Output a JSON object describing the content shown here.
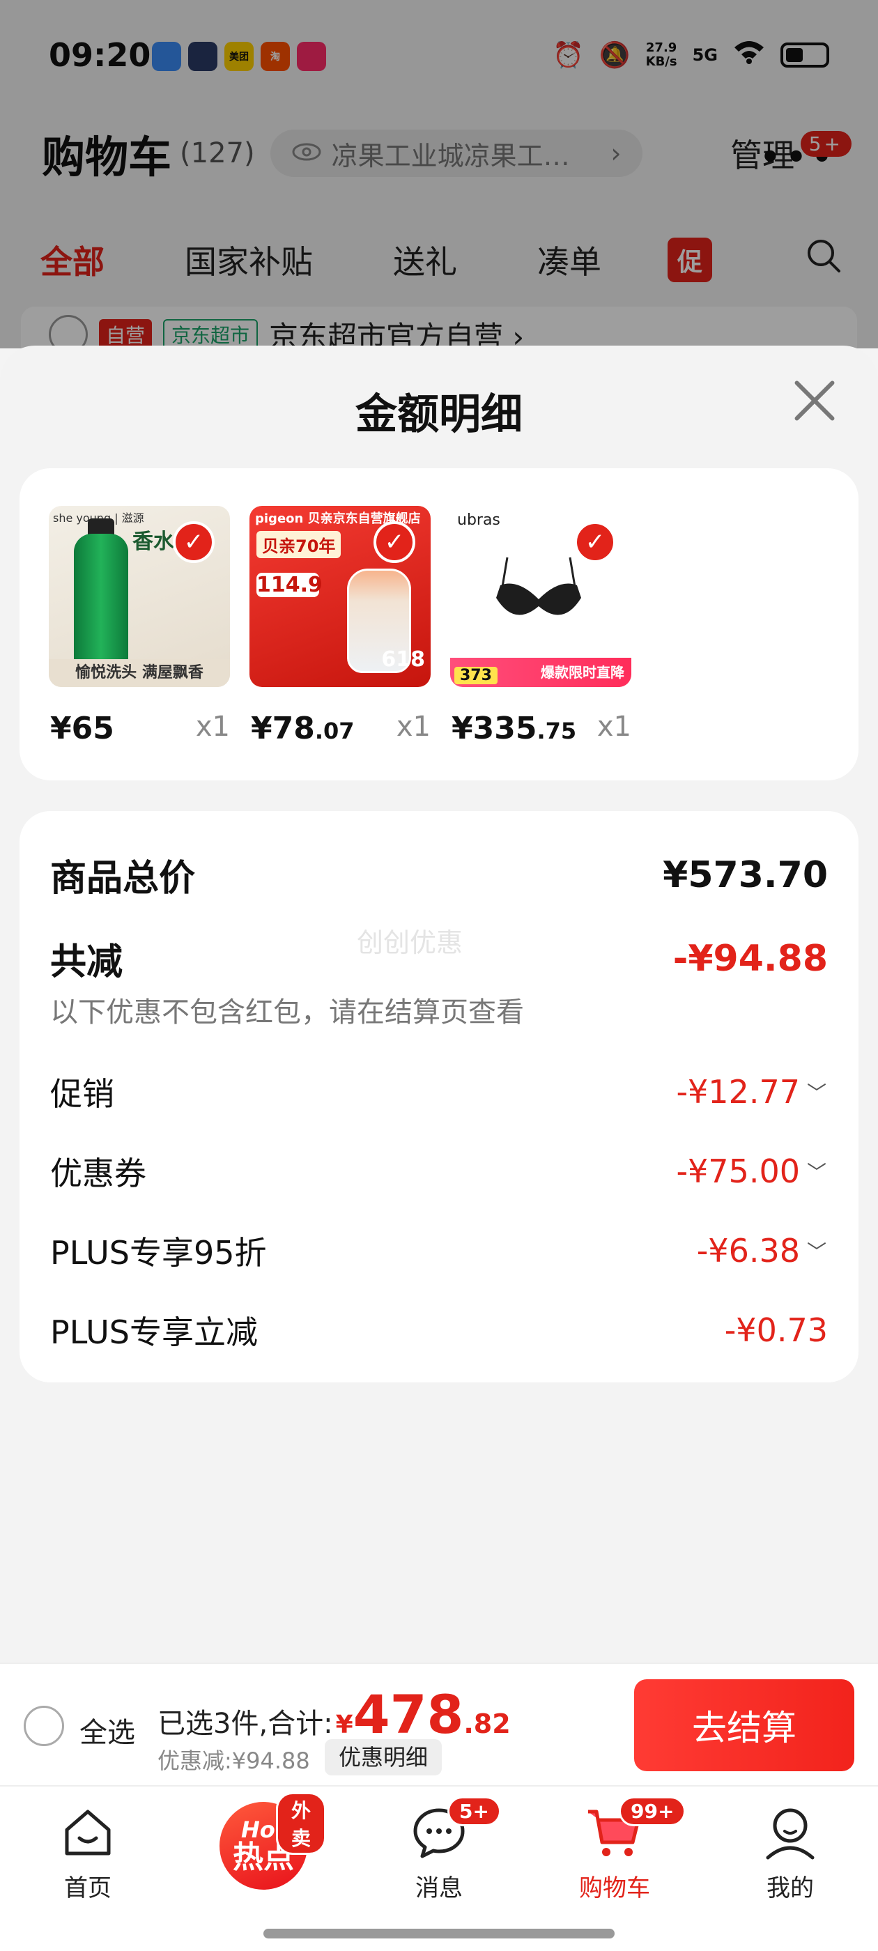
{
  "status_bar": {
    "time": "09:20",
    "net_speed_value": "27.9",
    "net_speed_unit": "KB/s",
    "signal": "5G",
    "app_icons": [
      {
        "name": "app-icon-1",
        "label": "",
        "color": "#3b8cf5"
      },
      {
        "name": "app-icon-2",
        "label": "",
        "color": "#2a3a66"
      },
      {
        "name": "app-icon-meituan",
        "label": "美团",
        "color": "#ffd100"
      },
      {
        "name": "app-icon-taobao",
        "label": "淘",
        "color": "#ff5000"
      },
      {
        "name": "app-icon-5",
        "label": "",
        "color": "#ff2d6a"
      }
    ]
  },
  "cart_header": {
    "title": "购物车",
    "count": "(127)",
    "address": "凉果工业城凉果工…",
    "manage": "管理",
    "more_badge": "5+"
  },
  "category_tabs": {
    "items": [
      "全部",
      "国家补贴",
      "送礼",
      "凑单"
    ],
    "promo": "促"
  },
  "store_row": {
    "tag": "自营",
    "tag2": "京东超市",
    "name": "京东超市官方自营 ›"
  },
  "sheet": {
    "title": "金额明细",
    "products": [
      {
        "price_int": "¥65",
        "price_dec": "",
        "qty": "x1",
        "img_brand": "she young | 滋源",
        "img_text": "香水级",
        "img_band": "愉悦洗头 满屋飘香"
      },
      {
        "price_int": "¥78",
        "price_dec": ".07",
        "qty": "x1",
        "img_brand": "pigeon 贝亲京东自营旗舰店",
        "img_head": "贝亲70年",
        "img_price": "114.9",
        "img_num": "618"
      },
      {
        "price_int": "¥335",
        "price_dec": ".75",
        "qty": "x1",
        "img_brand": "ubras",
        "img_price": "373",
        "img_strip": "爆款限时直降"
      }
    ],
    "total_label": "商品总价",
    "total_value": "¥573.70",
    "reduce_label": "共减",
    "reduce_value": "-¥94.88",
    "reduce_note": "以下优惠不包含红包，请在结算页查看",
    "watermark": "创创优惠",
    "items": [
      {
        "label": "促销",
        "value": "-¥12.77",
        "chevron": "﹀"
      },
      {
        "label": "优惠券",
        "value": "-¥75.00",
        "chevron": "﹀"
      },
      {
        "label": "PLUS专享95折",
        "value": "-¥6.38",
        "chevron": "﹀"
      },
      {
        "label": "PLUS专享立减",
        "value": "-¥0.73",
        "chevron": ""
      }
    ]
  },
  "checkout": {
    "select_all": "全选",
    "selected_text": "已选3件,合计:",
    "currency": "¥",
    "total_int": "478",
    "total_dec": ".82",
    "discount_text": "优惠减:¥94.88",
    "detail_button": "优惠明细",
    "checkout_button": "去结算"
  },
  "tab_bar": {
    "home": "首页",
    "hot_top": "Hot",
    "hot_main": "热点",
    "hot_badge": "外卖",
    "messages": "消息",
    "messages_badge": "5+",
    "cart": "购物车",
    "cart_badge": "99+",
    "mine": "我的"
  },
  "colors": {
    "accent": "#e2231a",
    "sheet_bg": "#f3f3f3"
  }
}
